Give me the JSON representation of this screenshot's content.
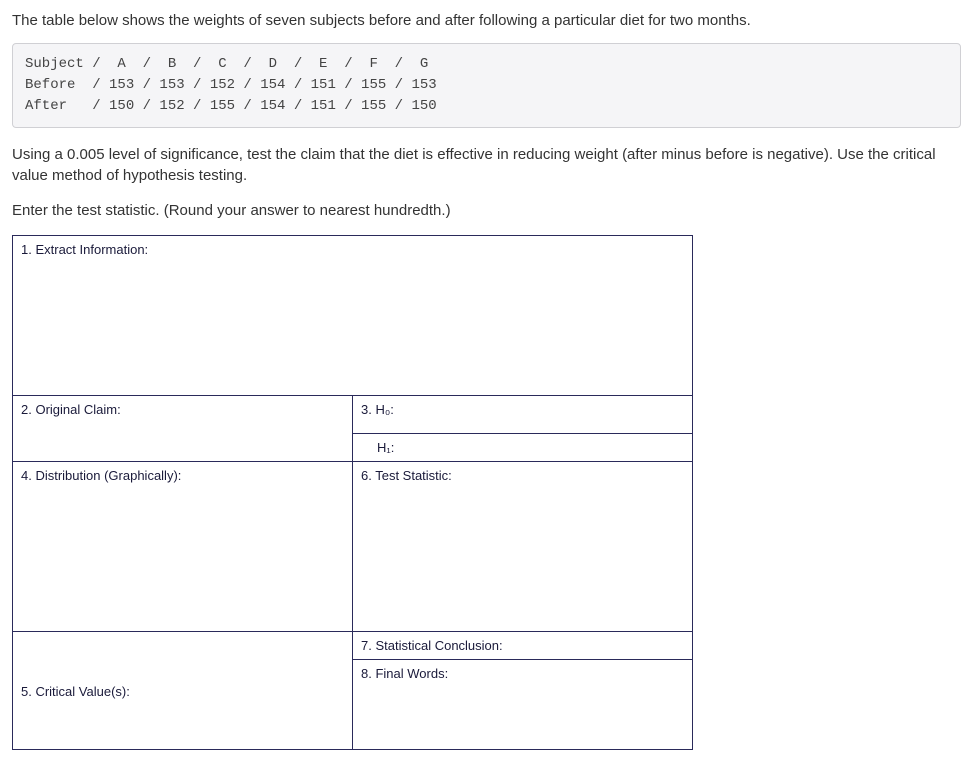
{
  "intro": "The table below shows the weights of seven subjects before and after following a particular diet for two months.",
  "data_table": {
    "row1": "Subject /  A  /  B  /  C  /  D  /  E  /  F  /  G",
    "row2": "Before  / 153 / 153 / 152 / 154 / 151 / 155 / 153",
    "row3": "After   / 150 / 152 / 155 / 154 / 151 / 155 / 150"
  },
  "para1": "Using a 0.005 level of significance, test the claim that the diet is effective in reducing weight (after minus before is negative). Use the critical value method of hypothesis testing.",
  "para2": "Enter the test statistic. (Round your answer to nearest hundredth.)",
  "worksheet": {
    "extract": "1. Extract Information:",
    "claim": "2. Original Claim:",
    "h0": "3. H₀:",
    "h1": "H₁:",
    "distribution": "4. Distribution (Graphically):",
    "test_stat": "6. Test Statistic:",
    "conclusion": "7. Statistical Conclusion:",
    "final": "8. Final Words:",
    "critical": "5. Critical Value(s):"
  }
}
